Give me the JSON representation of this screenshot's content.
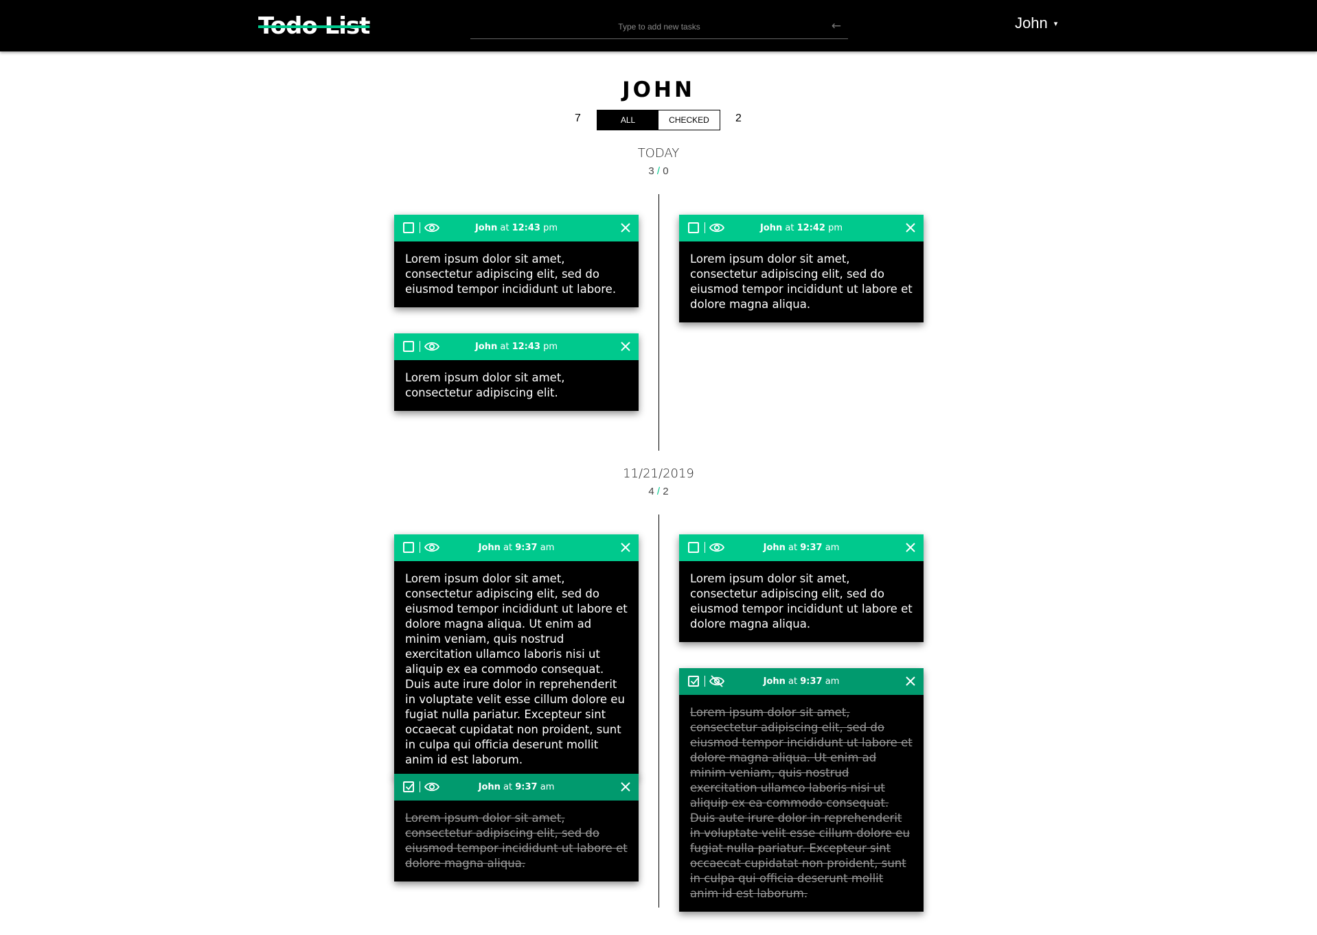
{
  "app": {
    "title": "Todo List"
  },
  "search": {
    "placeholder": "Type to add new tasks",
    "arrow": "←"
  },
  "user_menu": {
    "name": "John",
    "caret": "▾"
  },
  "profile": {
    "name": "JOHN",
    "count_all": "7",
    "count_checked": "2",
    "tab_all": "ALL",
    "tab_checked": "CHECKED"
  },
  "sections": [
    {
      "title": "TODAY",
      "created": "3",
      "sep": "/",
      "checked": "0",
      "cards": [
        {
          "author": "John",
          "at": "at",
          "time": "12:43",
          "ampm": "pm",
          "checked": false,
          "text": "Lorem ipsum dolor sit amet, consectetur adipiscing elit, sed do eiusmod tempor incididunt ut labore."
        },
        {
          "author": "John",
          "at": "at",
          "time": "12:42",
          "ampm": "pm",
          "checked": false,
          "text": "Lorem ipsum dolor sit amet, consectetur adipiscing elit, sed do eiusmod tempor incididunt ut labore et dolore magna aliqua."
        },
        {
          "author": "John",
          "at": "at",
          "time": "12:43",
          "ampm": "pm",
          "checked": false,
          "text": "Lorem ipsum dolor sit amet, consectetur adipiscing elit."
        }
      ]
    },
    {
      "title": "11/21/2019",
      "created": "4",
      "sep": "/",
      "checked": "2",
      "cards": [
        {
          "author": "John",
          "at": "at",
          "time": "9:37",
          "ampm": "am",
          "checked": false,
          "text": "Lorem ipsum dolor sit amet, consectetur adipiscing elit, sed do eiusmod tempor incididunt ut labore et dolore magna aliqua. Ut enim ad minim veniam, quis nostrud exercitation ullamco laboris nisi ut aliquip ex ea commodo consequat. Duis aute irure dolor in reprehenderit in voluptate velit esse cillum dolore eu fugiat nulla pariatur. Excepteur sint occaecat cupidatat non proident, sunt in culpa qui officia deserunt mollit anim id est laborum."
        },
        {
          "author": "John",
          "at": "at",
          "time": "9:37",
          "ampm": "am",
          "checked": false,
          "text": "Lorem ipsum dolor sit amet, consectetur adipiscing elit, sed do eiusmod tempor incididunt ut labore et dolore magna aliqua."
        },
        {
          "author": "John",
          "at": "at",
          "time": "9:37",
          "ampm": "am",
          "checked": true,
          "hidden": true,
          "text": "Lorem ipsum dolor sit amet, consectetur adipiscing elit, sed do eiusmod tempor incididunt ut labore et dolore magna aliqua. Ut enim ad minim veniam, quis nostrud exercitation ullamco laboris nisi ut aliquip ex ea commodo consequat. Duis aute irure dolor in reprehenderit in voluptate velit esse cillum dolore eu fugiat nulla pariatur. Excepteur sint occaecat cupidatat non proident, sunt in culpa qui officia deserunt mollit anim id est laborum."
        },
        {
          "author": "John",
          "at": "at",
          "time": "9:37",
          "ampm": "am",
          "checked": true,
          "text": "Lorem ipsum dolor sit amet, consectetur adipiscing elit, sed do eiusmod tempor incididunt ut labore et dolore magna aliqua."
        }
      ]
    }
  ],
  "colors": {
    "accent": "#00c98d",
    "accent_checked": "#019a6e",
    "card_bg": "#000000"
  }
}
